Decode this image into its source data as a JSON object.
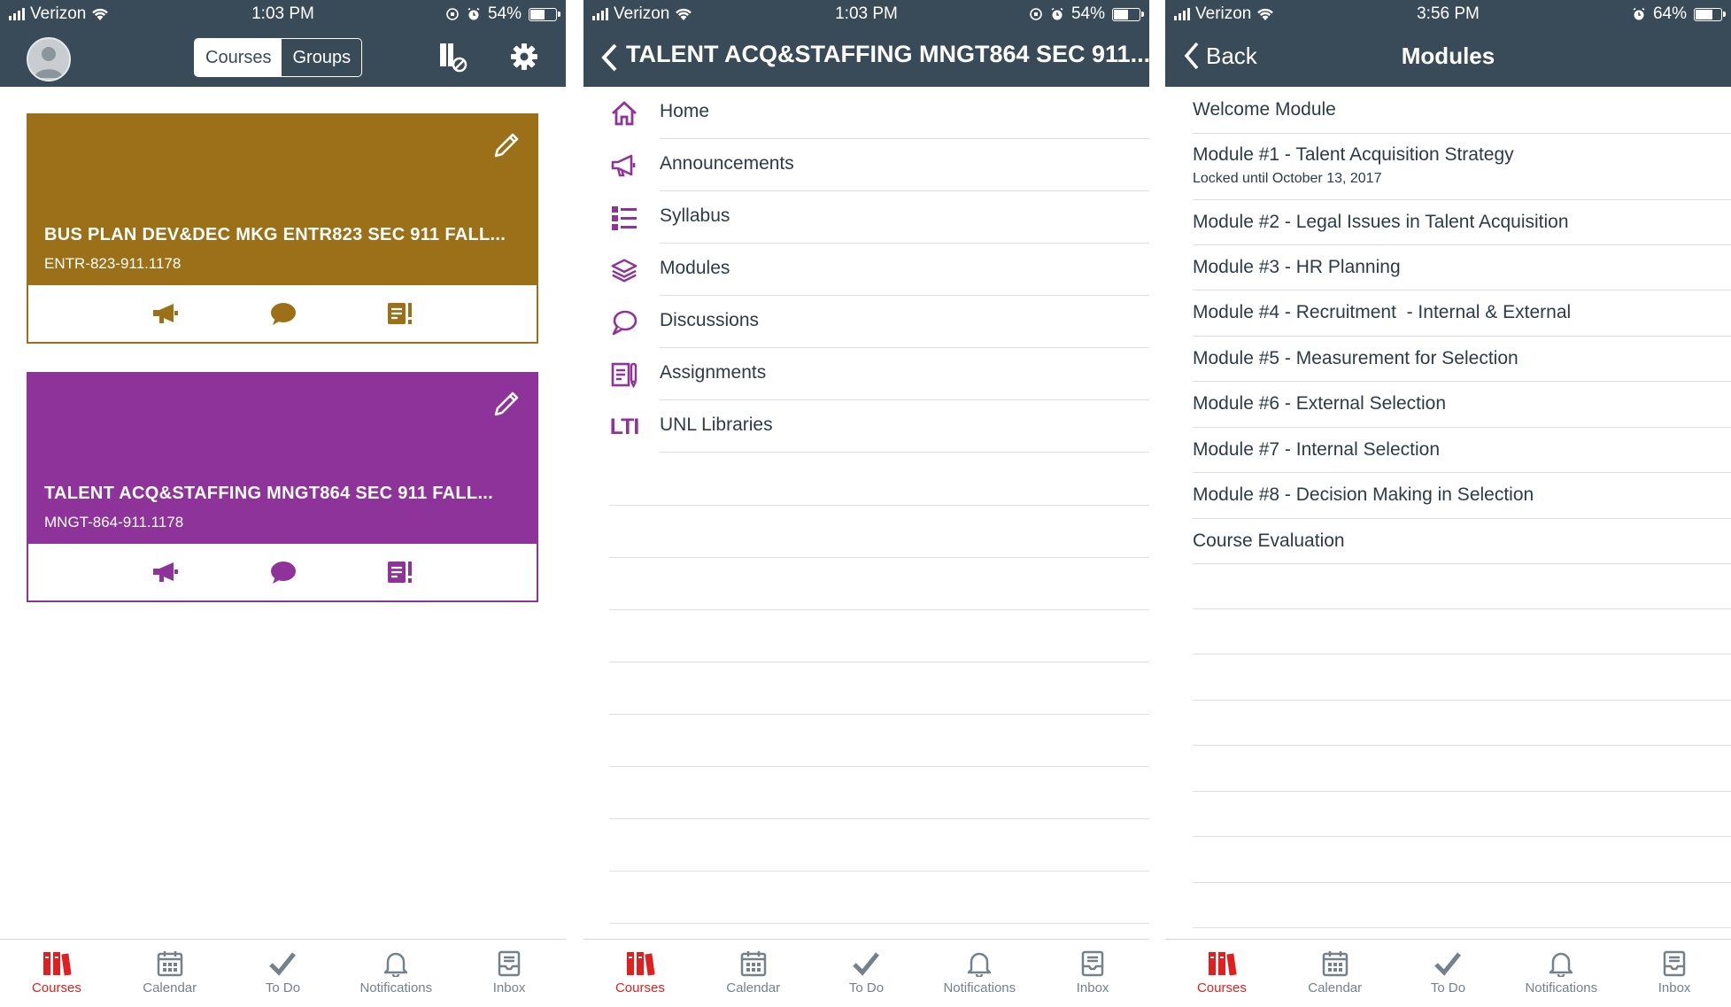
{
  "colors": {
    "header": "#394b58",
    "card1": "#9b7019",
    "card2": "#8e3399",
    "accent_tab": "#e02020",
    "purple_icon": "#8e3399"
  },
  "screen1": {
    "status": {
      "carrier": "Verizon",
      "time": "1:03 PM",
      "battery": "54%",
      "battery_level": 0.54
    },
    "segment": {
      "courses": "Courses",
      "groups": "Groups"
    },
    "cards": [
      {
        "title": "BUS PLAN DEV&DEC MKG ENTR823 SEC 911 FALL...",
        "code": "ENTR-823-911.1178",
        "color": "#9b7019"
      },
      {
        "title": "TALENT ACQ&STAFFING MNGT864 SEC 911 FALL...",
        "code": "MNGT-864-911.1178",
        "color": "#8e3399"
      }
    ],
    "tabs": [
      "Courses",
      "Calendar",
      "To Do",
      "Notifications",
      "Inbox"
    ]
  },
  "screen2": {
    "status": {
      "carrier": "Verizon",
      "time": "1:03 PM",
      "battery": "54%",
      "battery_level": 0.54
    },
    "title": "TALENT ACQ&STAFFING MNGT864 SEC 911...",
    "menu": [
      {
        "label": "Home",
        "icon": "home-icon"
      },
      {
        "label": "Announcements",
        "icon": "megaphone-icon"
      },
      {
        "label": "Syllabus",
        "icon": "list-icon"
      },
      {
        "label": "Modules",
        "icon": "layers-icon"
      },
      {
        "label": "Discussions",
        "icon": "chat-bubble-icon"
      },
      {
        "label": "Assignments",
        "icon": "assignment-icon"
      },
      {
        "label": "UNL Libraries",
        "icon": "lti-icon"
      }
    ],
    "lti_text": "LTI",
    "tabs": [
      "Courses",
      "Calendar",
      "To Do",
      "Notifications",
      "Inbox"
    ]
  },
  "screen3": {
    "status": {
      "carrier": "Verizon",
      "time": "3:56 PM",
      "battery": "64%",
      "battery_level": 0.64
    },
    "back": "Back",
    "title": "Modules",
    "modules": [
      {
        "title": "Welcome Module"
      },
      {
        "title": "Module #1 - Talent Acquisition Strategy",
        "subtitle": "Locked until October 13, 2017"
      },
      {
        "title": "Module #2 - Legal Issues in Talent Acquisition"
      },
      {
        "title": "Module #3 - HR Planning"
      },
      {
        "title": "Module #4 - Recruitment  - Internal & External"
      },
      {
        "title": "Module #5 - Measurement for Selection"
      },
      {
        "title": "Module #6 - External Selection"
      },
      {
        "title": "Module #7 - Internal Selection"
      },
      {
        "title": "Module #8 - Decision Making in Selection"
      },
      {
        "title": "Course Evaluation"
      }
    ],
    "tabs": [
      "Courses",
      "Calendar",
      "To Do",
      "Notifications",
      "Inbox"
    ]
  }
}
